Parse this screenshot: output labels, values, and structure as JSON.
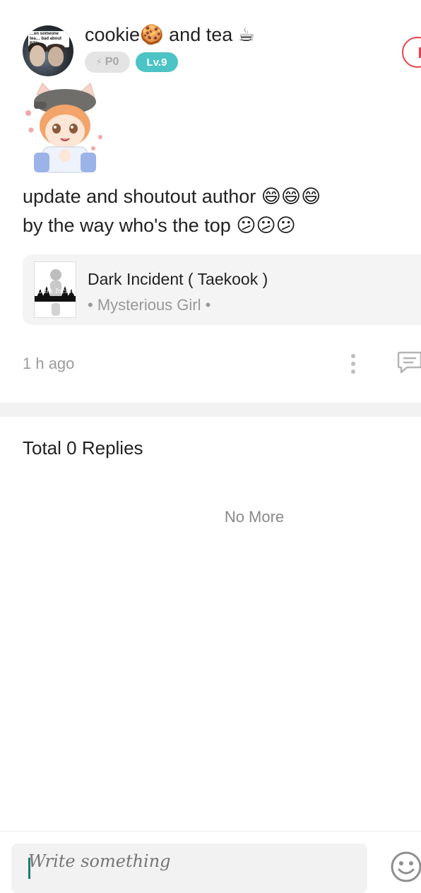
{
  "post": {
    "author": {
      "name": "cookie🍪 and tea ☕",
      "avatar_caption": "…en someone tea… bad about BTS:",
      "points_badge": "P0",
      "level_badge": "Lv.9"
    },
    "body_line1": "update and shoutout author 😄😄😄",
    "body_line2": "by the way who's the top 😕😕😕",
    "story": {
      "title": "Dark Incident ( Taekook )",
      "author": "• Mysterious Girl •",
      "cover_text": "Dark Incident"
    },
    "timestamp": "1 h ago"
  },
  "replies": {
    "title": "Total 0 Replies",
    "end_message": "No More"
  },
  "composer": {
    "placeholder": "Write something"
  },
  "colors": {
    "level_badge": "#4cc3c4",
    "follow_accent": "#e8434a",
    "cursor": "#1f7a6f"
  },
  "icons": {
    "points": "bolt-icon",
    "more": "more-vertical-icon",
    "reply": "comment-icon",
    "emoji": "smiley-icon"
  }
}
